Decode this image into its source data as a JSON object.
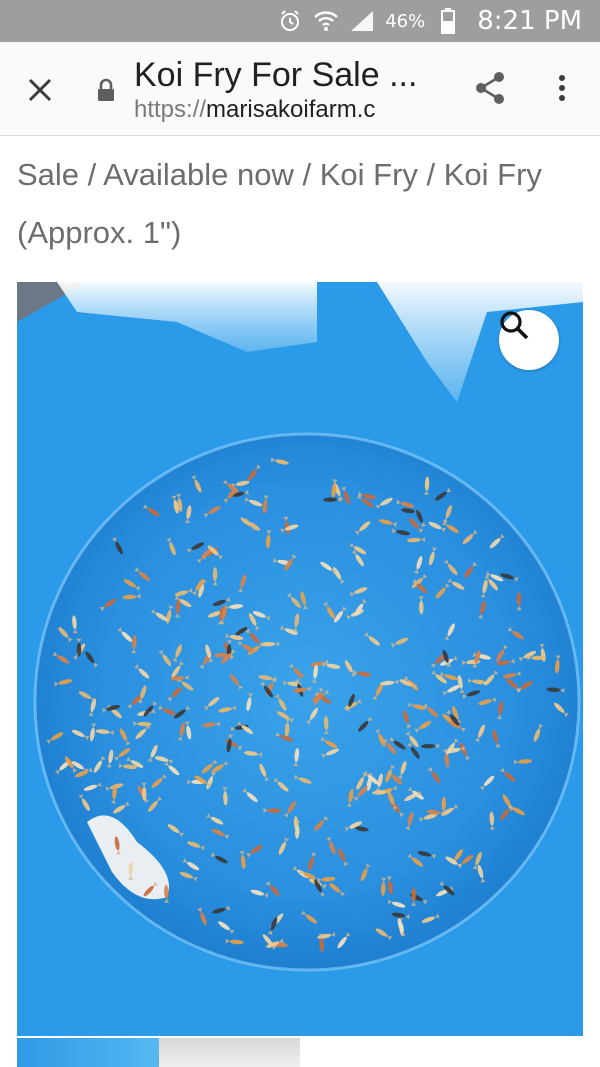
{
  "status_bar": {
    "battery_percent": "46%",
    "time": "8:21 PM",
    "icons": [
      "alarm-icon",
      "wifi-icon",
      "signal-icon",
      "battery-icon"
    ]
  },
  "toolbar": {
    "title": "Koi Fry For Sale ...",
    "url_scheme": "https://",
    "url_host": "marisakoifarm.c",
    "icons": [
      "close-icon",
      "lock-icon",
      "share-icon",
      "more-vert-icon"
    ]
  },
  "breadcrumb": {
    "text": "Sale / Available now / Koi Fry / Koi Fry (Approx. 1\")"
  },
  "product": {
    "zoom_icon": "magnifier-icon",
    "colors": {
      "water": "#2a94e2",
      "bucket": "#1f7fd0"
    }
  },
  "thumbnails": {
    "count": 2
  }
}
